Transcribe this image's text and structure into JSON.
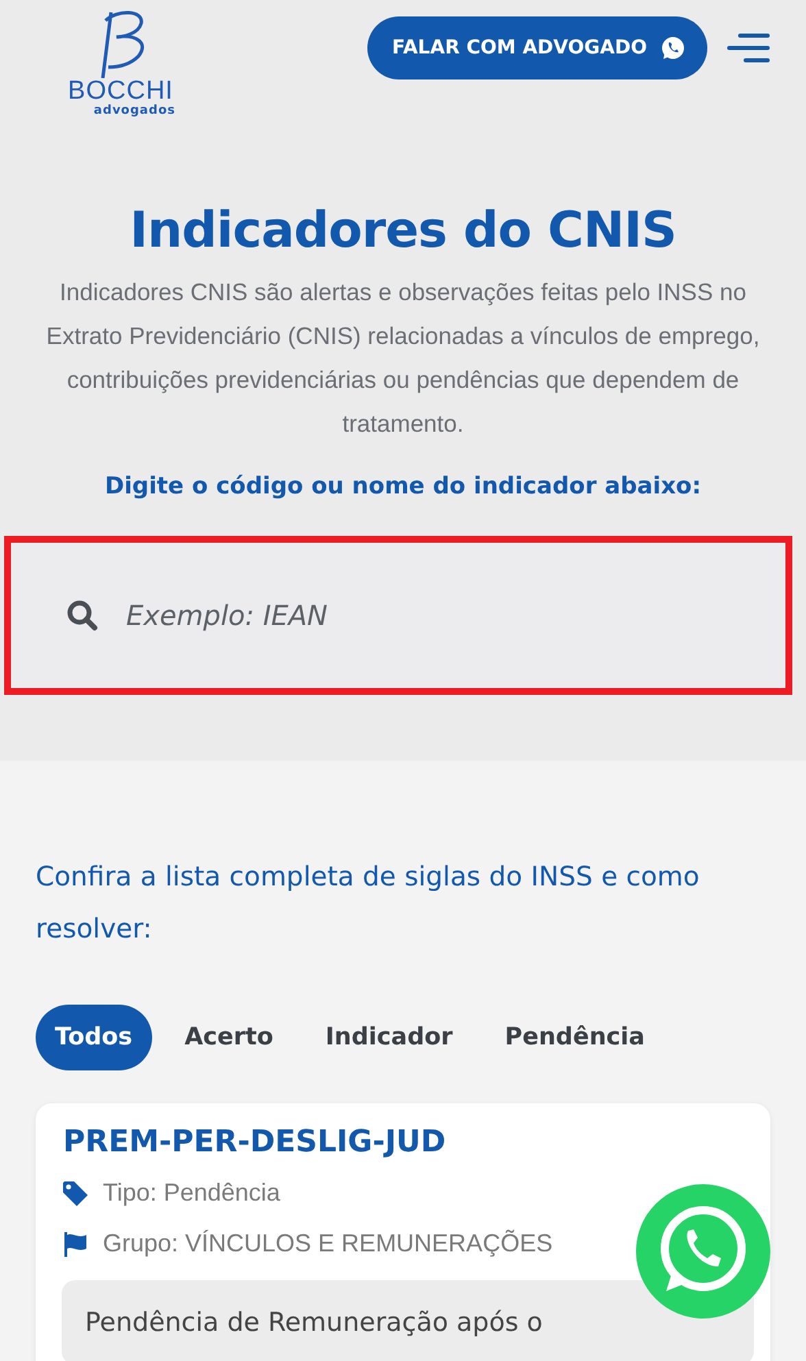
{
  "header": {
    "logo_name": "BOCCHI",
    "logo_sub": "advogados",
    "cta": "FALAR COM ADVOGADO"
  },
  "hero": {
    "title": "Indicadores do CNIS",
    "description": "Indicadores CNIS são alertas e observações feitas pelo INSS no Extrato Previdenciário (CNIS) relacionadas a vínculos de emprego, contribuições previdenciárias ou pendências que dependem de tratamento.",
    "prompt": "Digite o código ou nome do indicador abaixo:",
    "search": {
      "placeholder": "Exemplo: IEAN",
      "highlighted": true
    }
  },
  "list": {
    "heading": "Confira a lista completa de siglas do INSS e como resolver:",
    "tabs": [
      {
        "label": "Todos",
        "selected": true
      },
      {
        "label": "Acerto",
        "selected": false
      },
      {
        "label": "Indicador",
        "selected": false
      },
      {
        "label": "Pendência",
        "selected": false
      }
    ],
    "cards": [
      {
        "code": "PREM-PER-DESLIG-JUD",
        "type": "Tipo: Pendência",
        "group": "Grupo: VÍNCULOS E REMUNERAÇÕES",
        "description": "Pendência de Remuneração após o"
      }
    ]
  }
}
